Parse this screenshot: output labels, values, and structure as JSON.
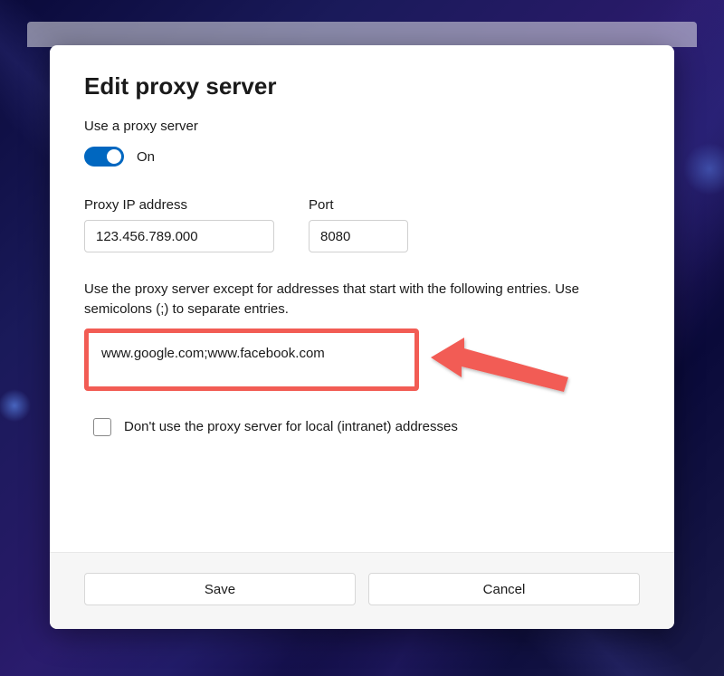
{
  "dialog": {
    "title": "Edit proxy server",
    "use_proxy_label": "Use a proxy server",
    "toggle_state": "On",
    "ip_label": "Proxy IP address",
    "ip_value": "123.456.789.000",
    "port_label": "Port",
    "port_value": "8080",
    "exceptions_description": "Use the proxy server except for addresses that start with the following entries. Use semicolons (;) to separate entries.",
    "exceptions_value": "www.google.com;www.facebook.com",
    "local_checkbox_label": "Don't use the proxy server for local (intranet) addresses",
    "local_checkbox_checked": false,
    "save_label": "Save",
    "cancel_label": "Cancel"
  },
  "annotation": {
    "highlight_color": "#f25c54"
  }
}
